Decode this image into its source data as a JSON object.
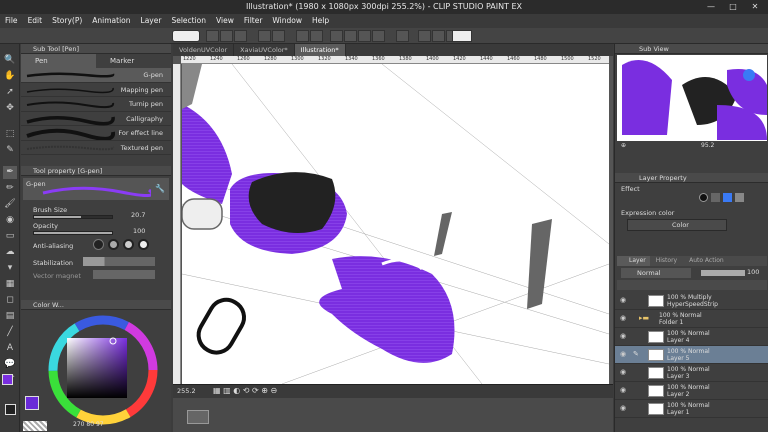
{
  "title": "Illustration* (1980 x 1080px 300dpi 255.2%) - CLIP STUDIO PAINT EX",
  "window_controls": {
    "minimize": "—",
    "maximize": "□",
    "close": "✕"
  },
  "menu": [
    "File",
    "Edit",
    "Story(P)",
    "Animation",
    "Layer",
    "Selection",
    "View",
    "Filter",
    "Window",
    "Help"
  ],
  "subtool_panel": {
    "header": "Sub Tool [Pen]",
    "tabs": [
      "Pen",
      "Marker"
    ],
    "brushes": [
      "G-pen",
      "Mapping pen",
      "Turnip pen",
      "Calligraphy",
      "For effect line",
      "Textured pen"
    ]
  },
  "tool_property": {
    "header": "Tool property [G-pen]",
    "preset_name": "G-pen",
    "brush_size_label": "Brush Size",
    "brush_size_value": "20.7",
    "brush_size_fraction": 0.6,
    "opacity_label": "Opacity",
    "opacity_value": "100",
    "opacity_fraction": 1.0,
    "anti_aliasing_label": "Anti-aliasing",
    "stabilization_label": "Stabilization",
    "vector_magnet_label": "Vector magnet"
  },
  "color_panel": {
    "header": "Color W...",
    "readout": [
      "270",
      "80",
      "97"
    ],
    "main_color": "#6a2ad8",
    "sub_color": "#7a3cf0"
  },
  "doc_tabs": [
    "VoldenUVColor",
    "XaviaUVColor*",
    "Illustration*"
  ],
  "ruler_ticks": [
    "1220",
    "1240",
    "1260",
    "1280",
    "1300",
    "1320",
    "1340",
    "1360",
    "1380",
    "1400",
    "1420",
    "1440",
    "1460",
    "1480",
    "1500",
    "1520"
  ],
  "status": {
    "zoom": "255.2"
  },
  "sub_view": {
    "header": "Sub View",
    "zoom": "95.2"
  },
  "layer_property": {
    "header": "Layer Property",
    "effect_label": "Effect",
    "expression_color_label": "Expression color",
    "expression_color_value": "Color"
  },
  "layer_panel": {
    "tabs": [
      "Layer",
      "History",
      "Auto Action"
    ],
    "blend_mode": "Normal",
    "opacity": "100",
    "layers": [
      {
        "line1": "100 % Multiply",
        "line2": "HyperSpeedStrip",
        "selected": false,
        "folder": false
      },
      {
        "line1": "100 % Normal",
        "line2": "Folder 1",
        "selected": false,
        "folder": true
      },
      {
        "line1": "100 % Normal",
        "line2": "Layer 4",
        "selected": false,
        "folder": false
      },
      {
        "line1": "100 % Normal",
        "line2": "Layer 5",
        "selected": true,
        "folder": false
      },
      {
        "line1": "100 % Normal",
        "line2": "Layer 3",
        "selected": false,
        "folder": false
      },
      {
        "line1": "100 % Normal",
        "line2": "Layer 2",
        "selected": false,
        "folder": false
      },
      {
        "line1": "100 % Normal",
        "line2": "Layer 1",
        "selected": false,
        "folder": false
      }
    ]
  },
  "colors": {
    "accent_purple": "#7a2ee0",
    "selection_blue": "#6b7f95"
  }
}
